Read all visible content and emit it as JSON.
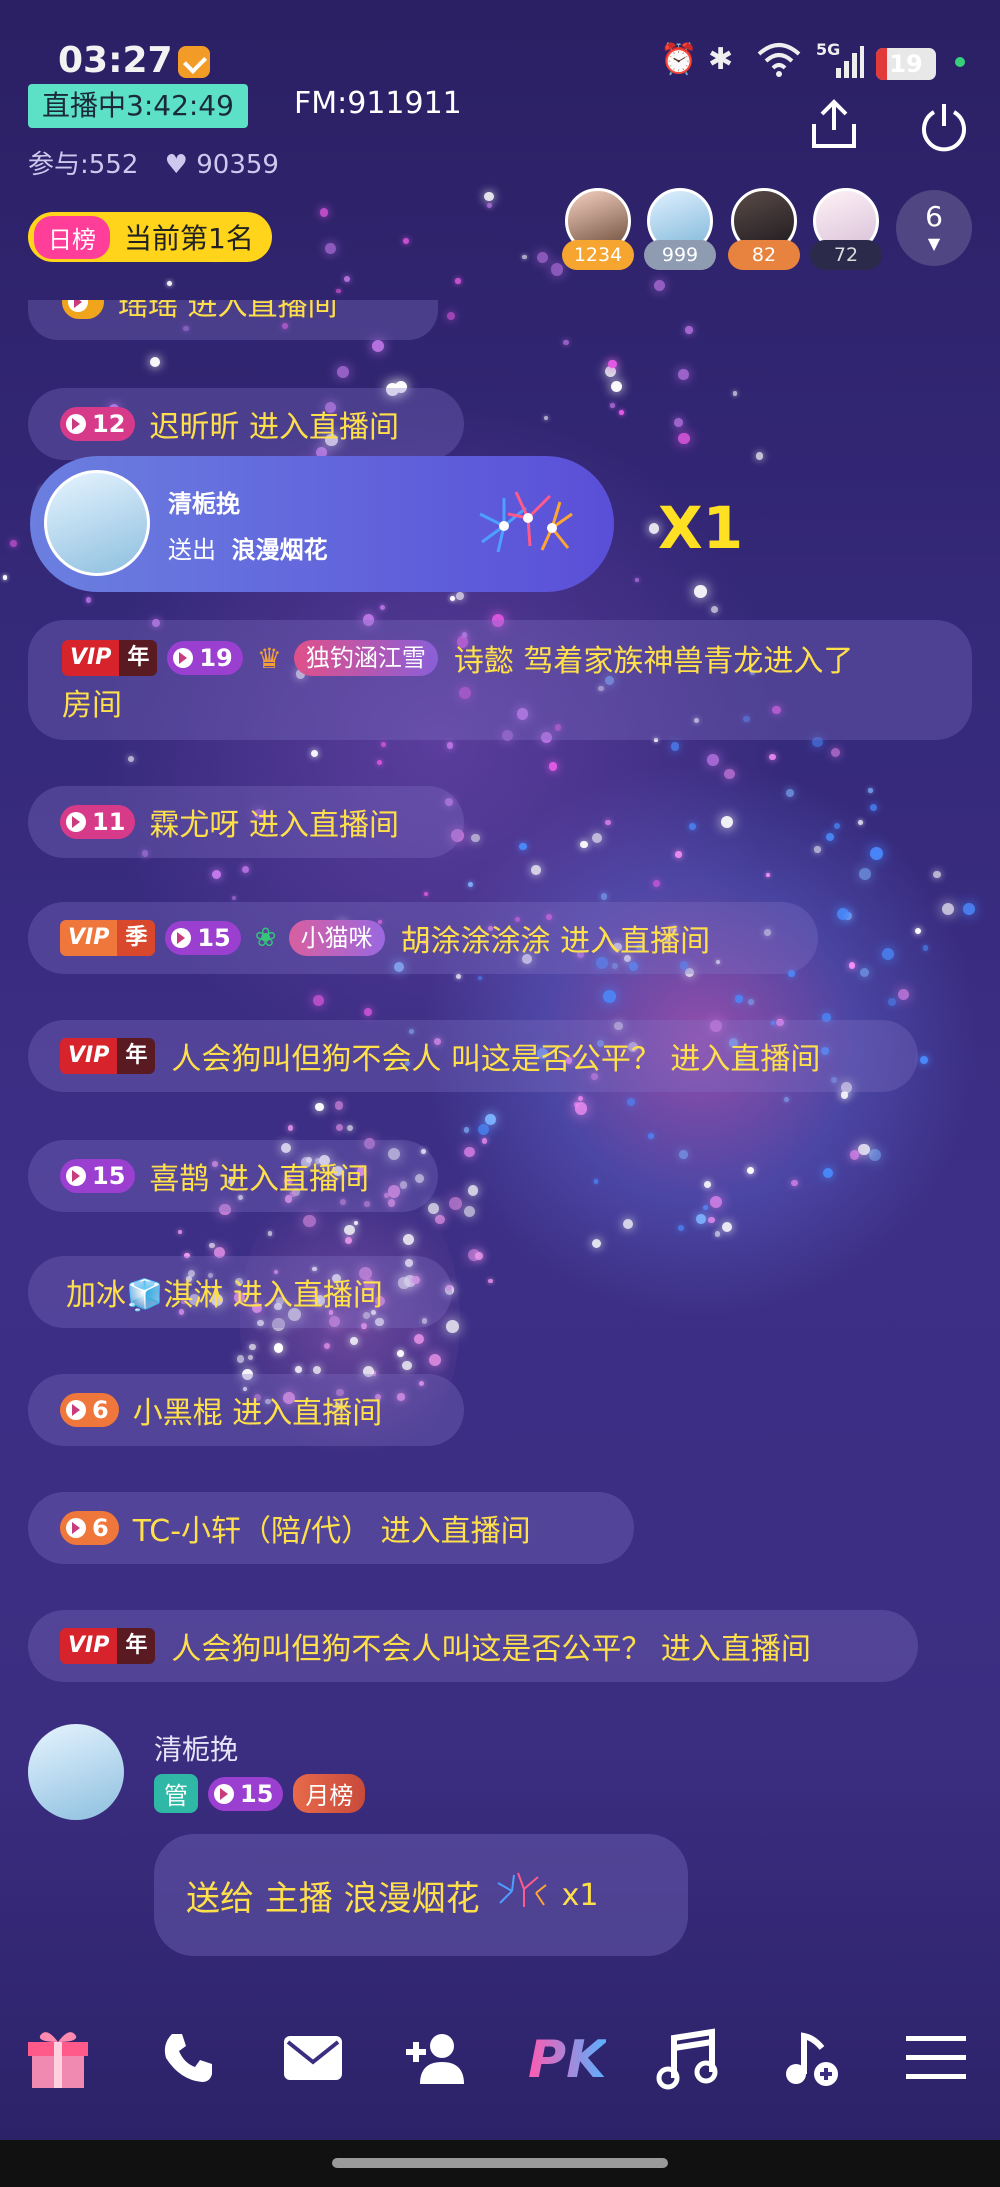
{
  "status_bar": {
    "time": "03:27",
    "battery_level": "19",
    "network": "5G",
    "icons": [
      "alarm-icon",
      "bluetooth-icon",
      "wifi-icon",
      "signal-icon",
      "battery-icon"
    ]
  },
  "live": {
    "timer": "直播中3:42:49",
    "fm": "FM:911911",
    "participants": "参与:552",
    "likes": "90359",
    "rank_tag": "日榜",
    "rank_text": "当前第1名",
    "viewers": [
      {
        "value": "1234",
        "color": "#f6a531"
      },
      {
        "value": "999",
        "color": "#8e9bb0"
      },
      {
        "value": "82",
        "color": "#e8833f"
      },
      {
        "value": "72",
        "color": "#2c2a4a"
      }
    ],
    "viewer_count": "6"
  },
  "gift_banner": {
    "sender": "清栀挽",
    "action": "送出",
    "gift": "浪漫烟花",
    "multiplier": "X1"
  },
  "chat": [
    {
      "text": "瑶瑶 进入直播间"
    },
    {
      "level": "12",
      "text": "迟昕昕 进入直播间"
    },
    {
      "vip": "年",
      "level": "19",
      "fan": "独钓涵江雪",
      "text_line1": "诗懿 驾着家族神兽青龙进入了",
      "text_line2": "房间"
    },
    {
      "level": "11",
      "text": "霖尤呀 进入直播间"
    },
    {
      "vip": "季",
      "level": "15",
      "fan": "小猫咪",
      "text": "胡涂涂涂涂 进入直播间"
    },
    {
      "vip": "年",
      "text": "人会狗叫但狗不会人 叫这是否公平？ 进入直播间"
    },
    {
      "level": "15",
      "text": "喜鹊 进入直播间"
    },
    {
      "text": "加冰🧊淇淋 进入直播间"
    },
    {
      "level": "6",
      "text": "小黑棍 进入直播间"
    },
    {
      "level": "6",
      "text": "TC-小轩（陪/代） 进入直播间"
    },
    {
      "vip": "年",
      "text": "人会狗叫但狗不会人叫这是否公平？ 进入直播间"
    }
  ],
  "last_message": {
    "user": "清栀挽",
    "badge_admin": "管",
    "level": "15",
    "badge_month": "月榜",
    "text": "送给 主播 浪漫烟花",
    "count": "x1"
  },
  "toolbar": [
    "gift-box-icon",
    "phone-icon",
    "mail-icon",
    "add-user-icon",
    "pk-icon",
    "music-icon",
    "music-add-icon",
    "menu-icon"
  ],
  "toolbar_pk_label": "PK",
  "colors": {
    "accent_yellow": "#ffe04a",
    "live_green": "#5ce0c6",
    "level_pink": "#d83a8a",
    "level_purple": "#9b3fd0",
    "level_orange": "#f0773c",
    "vip_red": "#d6232c"
  }
}
